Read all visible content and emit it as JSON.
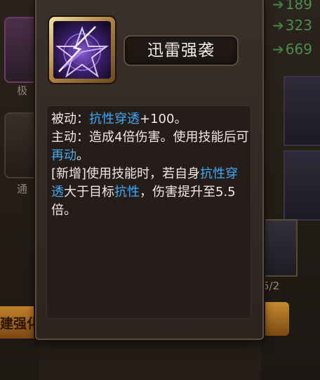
{
  "background": {
    "slot_labels": [
      "极",
      "通"
    ],
    "left_button_text": "建强化",
    "stats": [
      {
        "arrow": "➔",
        "value": "189"
      },
      {
        "arrow": "➔",
        "value": "323"
      },
      {
        "arrow": "➔",
        "value": "669"
      }
    ],
    "count": "5/2"
  },
  "skill": {
    "icon": "purple-lightning-star-icon",
    "name": "迅雷强袭",
    "desc": {
      "line1_label": "被动：",
      "line1_hl": "抗性穿透",
      "line1_rest": "+100。",
      "line2_label": "主动：造成4倍伤害。使用技能后可",
      "line2_hl": "再动",
      "line2_rest": "。",
      "line3_pre": "[新增]使用技能时，若自身",
      "line3_hl1": "抗性穿透",
      "line3_mid": "大于目标",
      "line3_hl2": "抗性",
      "line3_post": "，伤害提升至5.5倍。"
    }
  },
  "colors": {
    "highlight": "#46a9f0",
    "text": "#efe9e2",
    "frame_gold": "#b38742"
  }
}
